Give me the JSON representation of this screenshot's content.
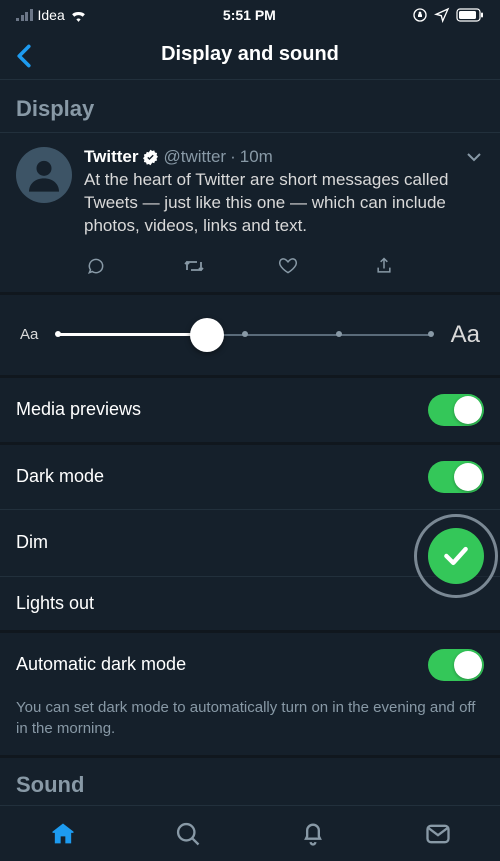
{
  "status": {
    "carrier": "Idea",
    "time": "5:51 PM"
  },
  "nav": {
    "title": "Display and sound"
  },
  "sections": {
    "display": "Display",
    "sound": "Sound"
  },
  "tweet": {
    "name": "Twitter",
    "handle": "@twitter",
    "time": "10m",
    "sep": "·",
    "text": "At the heart of Twitter are short messages called Tweets — just like this one — which can include photos, videos, links and text."
  },
  "fontSlider": {
    "smallLabel": "Aa",
    "largeLabel": "Aa"
  },
  "settings": {
    "mediaPreviews": {
      "label": "Media previews",
      "on": true
    },
    "darkMode": {
      "label": "Dark mode",
      "on": true
    },
    "dim": {
      "label": "Dim",
      "selected": true
    },
    "lightsOut": {
      "label": "Lights out",
      "selected": false
    },
    "autoDark": {
      "label": "Automatic dark mode",
      "on": true,
      "helper": "You can set dark mode to automatically turn on in the evening and off in the morning."
    }
  },
  "colors": {
    "accent": "#1d9bf0",
    "switchOn": "#34c759",
    "bg": "#15202b"
  }
}
